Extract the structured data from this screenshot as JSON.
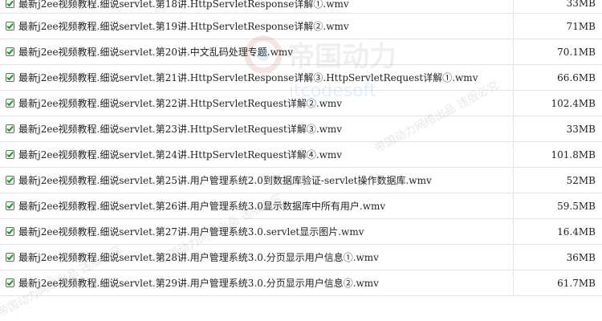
{
  "files": [
    {
      "name": "最新j2ee视频教程.细说servlet.第18讲.HttpServletResponse详解①.wmv",
      "size": "33MB",
      "checked": true
    },
    {
      "name": "最新j2ee视频教程.细说servlet.第19讲.HttpServletResponse详解②.wmv",
      "size": "71MB",
      "checked": true
    },
    {
      "name": "最新j2ee视频教程.细说servlet.第20讲.中文乱码处理专题.wmv",
      "size": "70.1MB",
      "checked": true
    },
    {
      "name": "最新j2ee视频教程.细说servlet.第21讲.HttpServletResponse详解③.HttpServletRequest详解①.wmv",
      "size": "66.6MB",
      "checked": true
    },
    {
      "name": "最新j2ee视频教程.细说servlet.第22讲.HttpServletRequest详解②.wmv",
      "size": "102.4MB",
      "checked": true
    },
    {
      "name": "最新j2ee视频教程.细说servlet.第23讲.HttpServletRequest详解③.wmv",
      "size": "33MB",
      "checked": true
    },
    {
      "name": "最新j2ee视频教程.细说servlet.第24讲.HttpServletRequest详解④.wmv",
      "size": "101.8MB",
      "checked": true
    },
    {
      "name": "最新j2ee视频教程.细说servlet.第25讲.用户管理系统2.0到数据库验证-servlet操作数据库.wmv",
      "size": "52MB",
      "checked": true
    },
    {
      "name": "最新j2ee视频教程.细说servlet.第26讲.用户管理系统3.0显示数据库中所有用户.wmv",
      "size": "59.5MB",
      "checked": true
    },
    {
      "name": "最新j2ee视频教程.细说servlet.第27讲.用户管理系统3.0.servlet显示图片.wmv",
      "size": "16.4MB",
      "checked": true
    },
    {
      "name": "最新j2ee视频教程.细说servlet.第28讲.用户管理系统3.0.分页显示用户信息①.wmv",
      "size": "36MB",
      "checked": true
    },
    {
      "name": "最新j2ee视频教程.细说servlet.第29讲.用户管理系统3.0.分页显示用户信息②.wmv",
      "size": "61.7MB",
      "checked": true
    }
  ],
  "watermark": {
    "brand": "帝国动力",
    "site": "itcodesoft",
    "diagonal_text": "帝国动力网络出品 违版必究"
  },
  "colors": {
    "checkmark": "#1a8c1a",
    "row_border": "#e4e4e4",
    "text": "#222222"
  }
}
